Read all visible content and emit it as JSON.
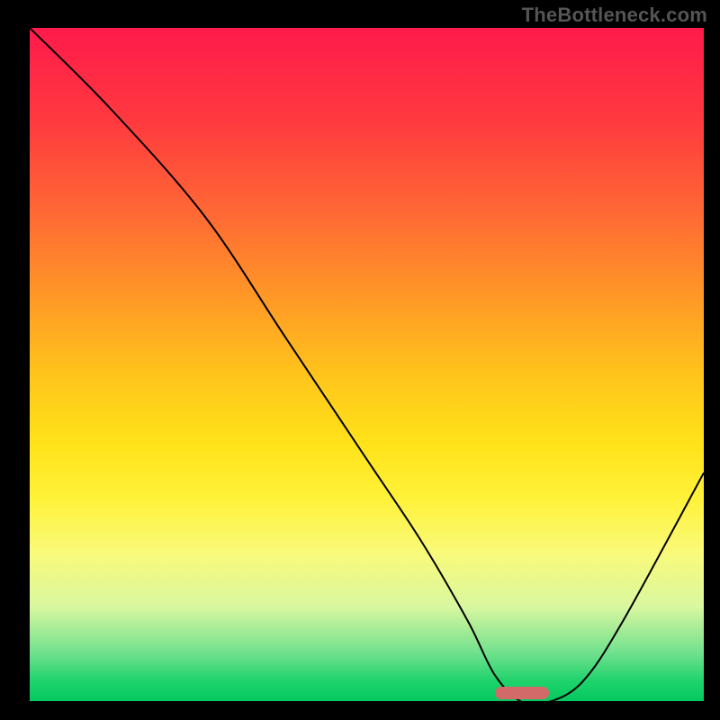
{
  "branding": {
    "text": "TheBottleneck.com"
  },
  "colors": {
    "background": "#000000",
    "gradient_top": "#ff1a4b",
    "gradient_bottom": "#05c85f",
    "curve": "#000000",
    "marker": "#d36a6a"
  },
  "chart_data": {
    "type": "line",
    "title": "",
    "xlabel": "",
    "ylabel": "",
    "xlim": [
      0,
      100
    ],
    "ylim": [
      0,
      100
    ],
    "x": [
      0,
      12,
      26,
      38,
      50,
      58,
      65,
      69,
      73,
      77,
      82,
      88,
      100
    ],
    "values": [
      100,
      88,
      72,
      54,
      36,
      24,
      12,
      4,
      0,
      0,
      3,
      12,
      34
    ],
    "marker": {
      "x_start": 69,
      "x_end": 77,
      "y": 0
    },
    "legend": [],
    "annotations": []
  }
}
